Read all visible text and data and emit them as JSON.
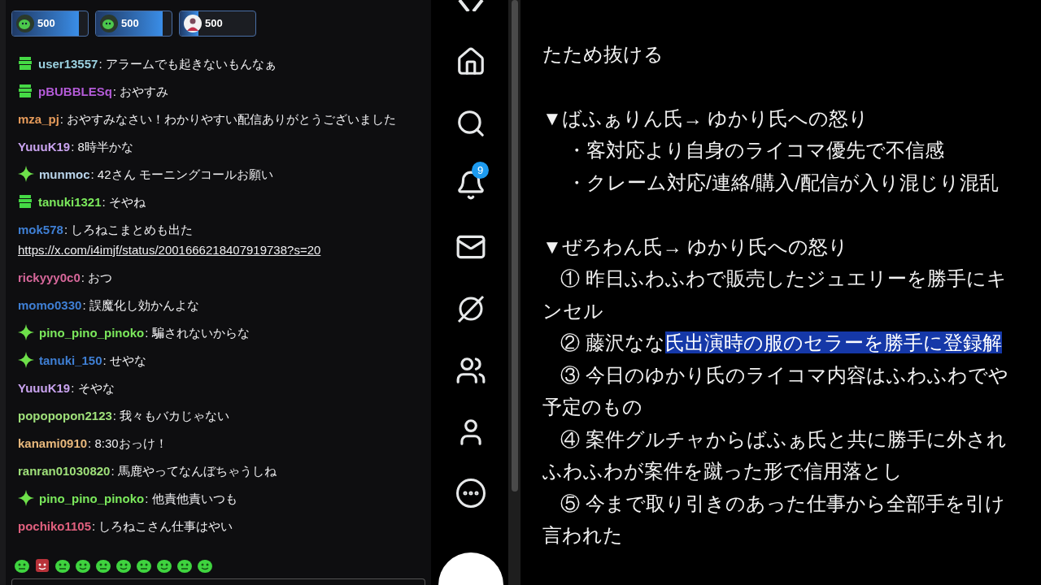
{
  "chat": {
    "separator": ":",
    "combos": [
      {
        "kind": "blob",
        "count": "500",
        "level": 0.88
      },
      {
        "kind": "blob",
        "count": "500",
        "level": 0.88
      },
      {
        "kind": "person",
        "count": "500",
        "level": 0.25
      }
    ],
    "messages": [
      {
        "kind": "gift",
        "user": "user13557",
        "color": "#9bd1e0",
        "text": "アラームでも起きないもんなぁ"
      },
      {
        "kind": "gift",
        "user": "pBUBBLESq",
        "color": "#b45bd8",
        "text": "おやすみ"
      },
      {
        "kind": "plain",
        "user": "mza_pj",
        "color": "#e59a5a",
        "text": "おやすみなさい！わかりやすい配信ありがとうございました"
      },
      {
        "kind": "plain",
        "user": "YuuuK19",
        "color": "#c9a3ef",
        "text": "8時半かな"
      },
      {
        "kind": "sparkle",
        "user": "munmoc",
        "color": "#b9d4ea",
        "text": "42さん モーニングコールお願い"
      },
      {
        "kind": "gift",
        "user": "tanuki1321",
        "color": "#7be85c",
        "text": "そやね"
      },
      {
        "kind": "plain",
        "user": "mok578",
        "color": "#3f7fd4",
        "text": "しろねこまとめも出た",
        "link": "https://x.com/i4imjf/status/2001666218407919738?s=20"
      },
      {
        "kind": "plain",
        "user": "rickyyy0c0",
        "color": "#d6679a",
        "text": "おつ"
      },
      {
        "kind": "plain",
        "user": "momo0330",
        "color": "#3f7fd4",
        "text": "誤魔化し効かんよな"
      },
      {
        "kind": "sparkle",
        "user": "pino_pino_pinoko",
        "color": "#7be85c",
        "text": "騙されないからな"
      },
      {
        "kind": "sparkle",
        "user": "tanuki_150",
        "color": "#3f7fd4",
        "text": "せやな"
      },
      {
        "kind": "plain",
        "user": "YuuuK19",
        "color": "#c9a3ef",
        "text": "そやな"
      },
      {
        "kind": "plain",
        "user": "popopopon2123",
        "color": "#9fe07a",
        "text": "我々もバカじゃない"
      },
      {
        "kind": "plain",
        "user": "kanami0910",
        "color": "#e8b87c",
        "text": "8:30おっけ！"
      },
      {
        "kind": "plain",
        "user": "ranran01030820",
        "color": "#9fe07a",
        "text": "馬鹿やってなんぼちゃうしね"
      },
      {
        "kind": "sparkle",
        "user": "pino_pino_pinoko",
        "color": "#7be85c",
        "text": "他責他責いつも"
      },
      {
        "kind": "plain",
        "user": "pochiko1105",
        "color": "#e0607e",
        "text": "しろねこさん仕事はやい"
      }
    ]
  },
  "sidebar": {
    "notification_count": "9"
  },
  "document": {
    "lines": [
      {
        "kind": "plain",
        "text": "たため抜ける"
      },
      {
        "kind": "blank"
      },
      {
        "kind": "plain",
        "text": "▼ばふぁりん氏→ ゆかり氏への怒り"
      },
      {
        "kind": "bullet",
        "text": "・客対応より自身のライコマ優先で不信感"
      },
      {
        "kind": "bullet",
        "text": "・クレーム対応/連絡/購入/配信が入り混じり混乱"
      },
      {
        "kind": "blank"
      },
      {
        "kind": "plain",
        "text": "▼ぜろわん氏→ ゆかり氏への怒り"
      },
      {
        "kind": "numbered",
        "text": "① 昨日ふわふわで販売したジュエリーを勝手にキ"
      },
      {
        "kind": "plain",
        "text": "ンセル"
      },
      {
        "kind": "numbered",
        "text": "② 藤沢なな",
        "highlighted_text": "氏出演時の服のセラーを勝手に登録解"
      },
      {
        "kind": "numbered",
        "text": "③ 今日のゆかり氏のライコマ内容はふわふわでや"
      },
      {
        "kind": "plain",
        "text": "予定のもの"
      },
      {
        "kind": "numbered",
        "text": "④ 案件グルチャからばふぁ氏と共に勝手に外され"
      },
      {
        "kind": "plain",
        "text": "ふわふわが案件を蹴った形で信用落とし"
      },
      {
        "kind": "numbered",
        "text": "⑤ 今まで取り引きのあった仕事から全部手を引け"
      },
      {
        "kind": "plain",
        "text": "言われた"
      }
    ]
  }
}
